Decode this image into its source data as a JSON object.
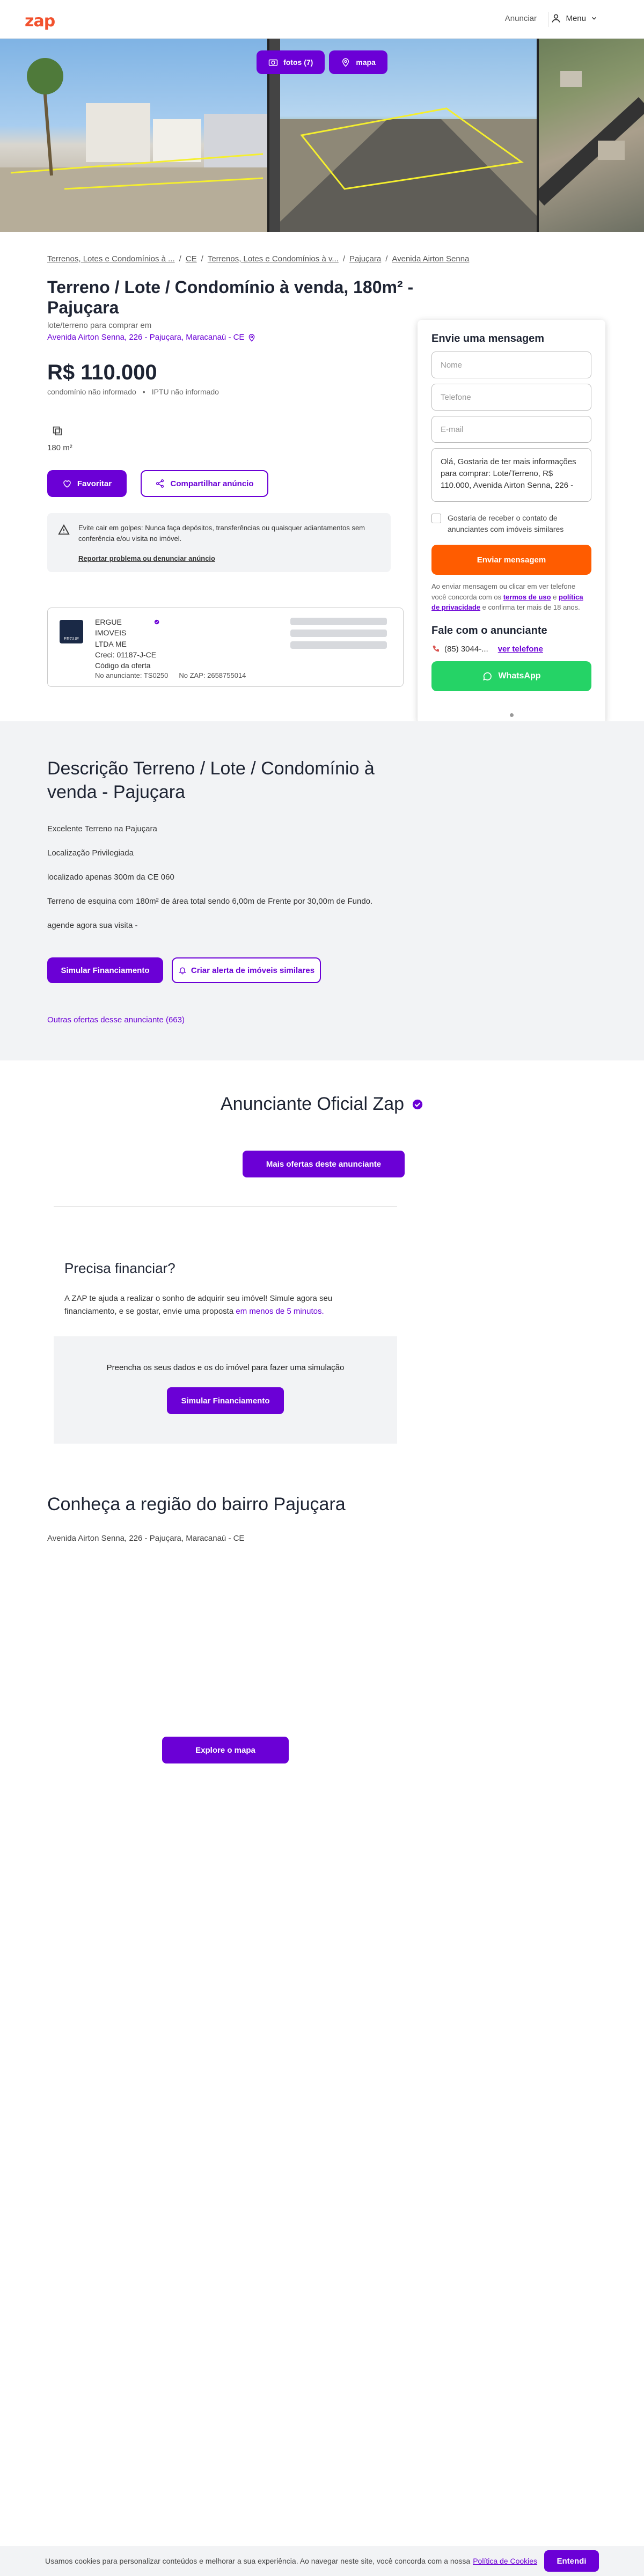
{
  "colors": {
    "brand": "#6b00d6",
    "accent_orange": "#ff5c00",
    "logo": "#f2522e",
    "whatsapp": "#25d366"
  },
  "header": {
    "logo": "zap",
    "advertise_link": "Anunciar",
    "menu_label": "Menu"
  },
  "gallery": {
    "photos_button": "fotos (7)",
    "map_button": "mapa"
  },
  "breadcrumb": [
    "Terrenos, Lotes e Condomínios à ...",
    "CE",
    "Terrenos, Lotes e Condomínios à v...",
    "Pajuçara",
    "Avenida Airton Senna"
  ],
  "listing": {
    "title": "Terreno / Lote / Condomínio à venda, 180m² - Pajuçara",
    "address_label": "lote/terreno para comprar em",
    "address": "Avenida Airton Senna, 226 - Pajuçara, Maracanaú - CE",
    "price": "R$ 110.000",
    "condo_fee": "condomínio não informado",
    "iptu": "IPTU não informado",
    "area": "180 m²",
    "favorite_button": "Favoritar",
    "share_button": "Compartilhar anúncio"
  },
  "warning": {
    "text": "Evite cair em golpes: Nunca faça depósitos, transferências ou quaisquer adiantamentos sem conferência e/ou visita no imóvel.",
    "report_link": "Reportar problema ou denunciar anúncio"
  },
  "advertiser": {
    "logo_text": "ERGUE",
    "name": "ERGUE IMOVEIS LTDA ME",
    "creci": "Creci: 01187-J-CE",
    "offer_code_label": "Código da oferta",
    "advertiser_number": "No anunciante: TS0250",
    "zap_number": "No ZAP: 2658755014"
  },
  "contact": {
    "title": "Envie uma mensagem",
    "name_placeholder": "Nome",
    "phone_placeholder": "Telefone",
    "email_placeholder": "E-mail",
    "message": "Olá, Gostaria de ter mais informações para comprar: Lote/Terreno, R$ 110.000, Avenida Airton Senna, 226 -",
    "checkbox_label": "Gostaria de receber o contato de anunciantes com imóveis similares",
    "send_button": "Enviar mensagem",
    "terms_prefix": "Ao enviar mensagem ou clicar em ver telefone você concorda com os",
    "terms_link": "termos de uso",
    "terms_and": "e",
    "privacy_link": "política de privacidade",
    "terms_suffix": "e confirma ter mais de 18 anos.",
    "advertiser_title": "Fale com o anunciante",
    "phone": "(85) 3044-...",
    "see_phone": "ver telefone",
    "whatsapp_button": "WhatsApp"
  },
  "description": {
    "title": "Descrição Terreno / Lote / Condomínio à venda - Pajuçara",
    "lines": [
      "Excelente Terreno na Pajuçara",
      "Localização Privilegiada",
      "localizado apenas 300m da CE 060",
      "Terreno de esquina com 180m² de área total sendo 6,00m de Frente por 30,00m de Fundo.",
      "agende agora sua visita -"
    ],
    "simulate_button": "Simular Financiamento",
    "alert_button": "Criar alerta de imóveis similares",
    "other_offers": "Outras ofertas desse anunciante (663)"
  },
  "official": {
    "title": "Anunciante Oficial Zap",
    "more_offers_button": "Mais ofertas deste anunciante"
  },
  "financing": {
    "title": "Precisa financiar?",
    "text": "A ZAP te ajuda a realizar o sonho de adquirir seu imóvel! Simule agora seu financiamento, e se gostar, envie uma proposta",
    "text_highlight": "em menos de 5 minutos.",
    "box_text": "Preencha os seus dados e os do imóvel para fazer uma simulação",
    "button": "Simular Financiamento"
  },
  "region": {
    "title": "Conheça a região do bairro Pajuçara",
    "address": "Avenida Airton Senna, 226 - Pajuçara, Maracanaú - CE",
    "map_button": "Explore o mapa"
  },
  "cookie": {
    "text": "Usamos cookies para personalizar conteúdos e melhorar a sua experiência. Ao navegar neste site, você concorda com a nossa",
    "link": "Política de Cookies",
    "button": "Entendi"
  }
}
